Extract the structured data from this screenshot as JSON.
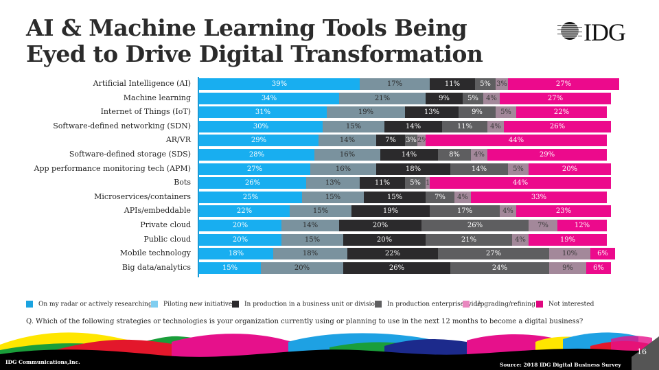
{
  "header": {
    "title_line1": "AI & Machine Learning Tools Being",
    "title_line2": "Eyed to Drive Digital Transformation",
    "logo_text": "IDG"
  },
  "chart_data": {
    "type": "bar",
    "orientation": "horizontal",
    "stacked": true,
    "title": "AI & Machine Learning Tools Being Eyed to Drive Digital Transformation",
    "xlabel": "",
    "ylabel": "",
    "xlim": [
      0,
      100
    ],
    "grid": false,
    "legend_position": "bottom",
    "categories": [
      "Artificial Intelligence (AI)",
      "Machine learning",
      "Internet of Things (IoT)",
      "Software-defined networking (SDN)",
      "AR/VR",
      "Software-defined storage (SDS)",
      "App performance monitoring tech (APM)",
      "Bots",
      "Microservices/containers",
      "APIs/embeddable",
      "Private cloud",
      "Public cloud",
      "Mobile technology",
      "Big data/analytics"
    ],
    "series": [
      {
        "name": "On my radar or actively researching",
        "color": "#18aef0",
        "label_color": "#ffffff",
        "values": [
          39,
          34,
          31,
          30,
          29,
          28,
          27,
          26,
          25,
          22,
          20,
          20,
          18,
          15
        ]
      },
      {
        "name": "Piloting new initiatives",
        "color": "#7a929e",
        "label_color": "#2a2a2a",
        "values": [
          17,
          21,
          19,
          15,
          14,
          16,
          16,
          13,
          15,
          15,
          14,
          15,
          18,
          20
        ]
      },
      {
        "name": "In production in a business unit or division",
        "color": "#2b2a2c",
        "label_color": "#ffffff",
        "values": [
          11,
          9,
          13,
          14,
          7,
          14,
          18,
          11,
          15,
          19,
          20,
          20,
          22,
          26
        ]
      },
      {
        "name": "In production enterprise wide",
        "color": "#5e5e60",
        "label_color": "#ffffff",
        "values": [
          5,
          5,
          9,
          11,
          3,
          8,
          14,
          5,
          7,
          17,
          26,
          21,
          27,
          24
        ]
      },
      {
        "name": "Upgrading/refining",
        "color": "#a3889a",
        "label_color": "#3a3a3a",
        "values": [
          3,
          4,
          5,
          4,
          2,
          4,
          5,
          1,
          4,
          4,
          7,
          4,
          10,
          9
        ]
      },
      {
        "name": "Not interested",
        "color": "#ec0a8c",
        "label_color": "#ffffff",
        "values": [
          27,
          27,
          22,
          26,
          44,
          29,
          20,
          44,
          33,
          23,
          12,
          19,
          6,
          6
        ]
      }
    ]
  },
  "legend": {
    "items": [
      {
        "label": "On my radar or actively researching",
        "color": "#1aa3e0"
      },
      {
        "label": "Piloting new initiatives",
        "color": "#7fcdf0"
      },
      {
        "label": "In production in a business unit or division",
        "color": "#2b2a2c"
      },
      {
        "label": "In production enterprise wide",
        "color": "#5e5e60"
      },
      {
        "label": "Upgrading/refining",
        "color": "#e987bf"
      },
      {
        "label": "Not interested",
        "color": "#e0087f"
      }
    ]
  },
  "question": "Q. Which of the following strategies or technologies is your organization currently using or planning to use in the next 12 months to become a digital business?",
  "footer": {
    "company": "IDG Communications,Inc.",
    "source": "Source: 2018 IDG Digital Business Survey",
    "page_number": "16"
  }
}
